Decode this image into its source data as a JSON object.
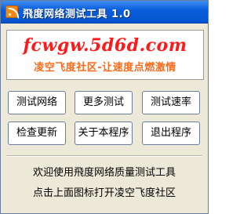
{
  "window": {
    "title": "飛度网络测试工具 1.0"
  },
  "banner": {
    "url": "fcwgw.5d6d.com",
    "slogan": "凌空飞度社区-让速度点燃激情"
  },
  "buttons": {
    "test_network": "测试网络",
    "more_tests": "更多测试",
    "test_speed": "测试速率",
    "check_update": "检查更新",
    "about": "关于本程序",
    "exit": "退出程序"
  },
  "messages": {
    "welcome": "欢迎使用飛度网络质量测试工具",
    "hint": "点击上面图标打开凌空飞度社区"
  },
  "colors": {
    "banner_url": "#ff1a1a",
    "banner_slogan": "#ff6a1a",
    "titlebar": "#0a5fdc"
  },
  "icons": {
    "app": "rss-feed-icon"
  }
}
